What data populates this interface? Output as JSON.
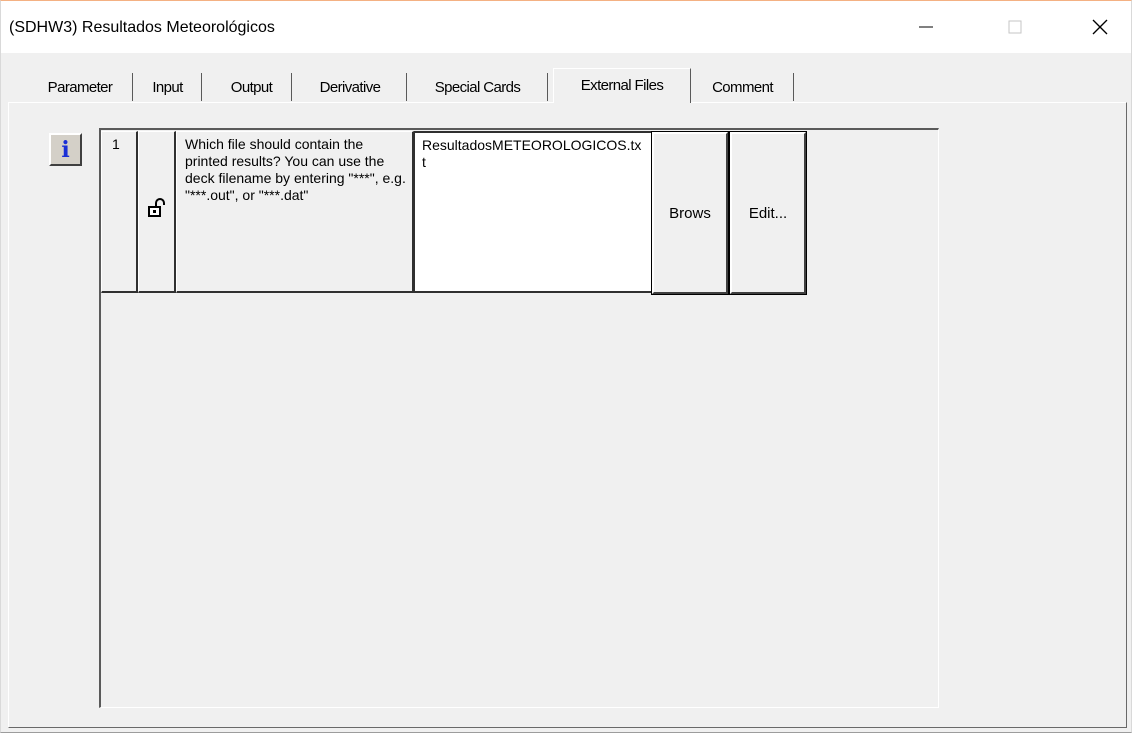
{
  "window": {
    "title": "(SDHW3) Resultados Meteorológicos",
    "minimize_icon": "minimize-icon",
    "maximize_icon": "maximize-icon",
    "close_icon": "close-icon"
  },
  "tabs": [
    {
      "label": "Parameter",
      "active": false
    },
    {
      "label": "Input",
      "active": false
    },
    {
      "label": "Output",
      "active": false
    },
    {
      "label": "Derivative",
      "active": false
    },
    {
      "label": "Special Cards",
      "active": false
    },
    {
      "label": "External Files",
      "active": true
    },
    {
      "label": "Comment",
      "active": false
    }
  ],
  "info_button": {
    "icon": "info-icon",
    "glyph": "i"
  },
  "rows": [
    {
      "number": "1",
      "lock_icon": "unlocked-padlock-icon",
      "description": "Which file should contain the printed results? You can use the deck filename by entering \"***\", e.g. \"***.out\", or \"***.dat\"",
      "value": "ResultadosMETEOROLOGICOS.txt",
      "browse_label": "Brows",
      "edit_label": "Edit..."
    }
  ],
  "colors": {
    "window_bg": "#f0f0f0",
    "info_glyph": "#1a2fd6",
    "title_border": "#f4b183"
  }
}
